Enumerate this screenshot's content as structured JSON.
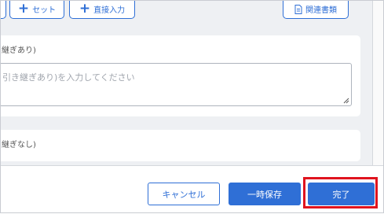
{
  "toolbar": {
    "set_label": "セット",
    "direct_input_label": "直接入力",
    "related_docs_label": "関連書類"
  },
  "sections": [
    {
      "label": "継ぎあり)",
      "placeholder": "引き継ぎあり)を入力してください"
    },
    {
      "label": "継ぎなし)"
    }
  ],
  "footer": {
    "cancel_label": "キャンセル",
    "draft_label": "一時保存",
    "complete_label": "完了"
  },
  "colors": {
    "accent": "#2f6fd6",
    "highlight": "#e0141e"
  }
}
